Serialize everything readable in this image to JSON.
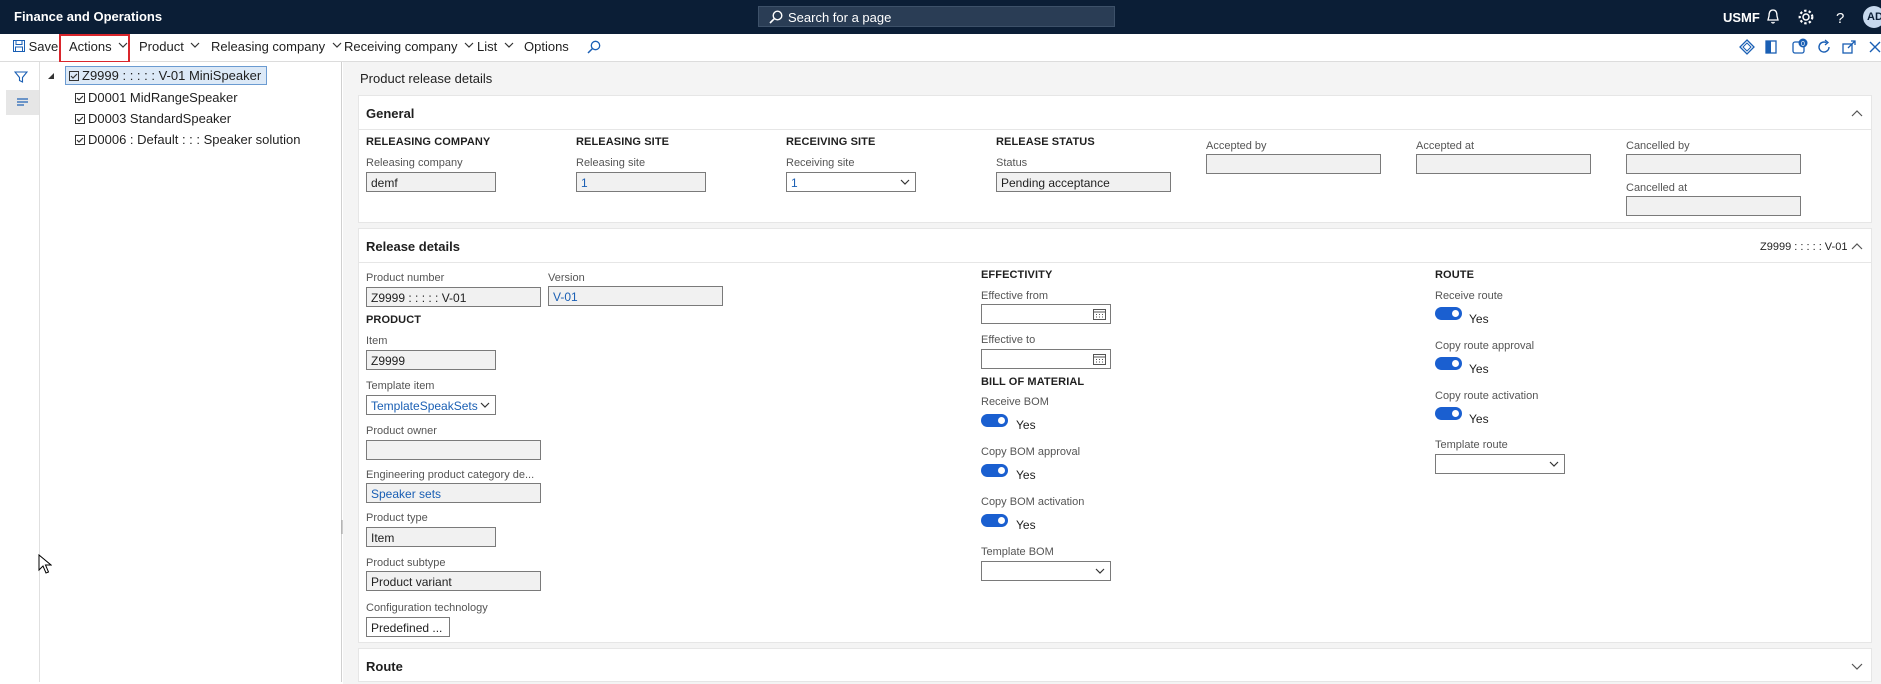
{
  "topbar": {
    "app_title": "Finance and Operations",
    "search_placeholder": "Search for a page",
    "company": "USMF",
    "avatar": "AD",
    "icons": [
      "bell-icon",
      "gear-icon",
      "help-icon"
    ]
  },
  "actionbar": {
    "save": "Save",
    "actions": "Actions",
    "product": "Product",
    "releasing_company": "Releasing company",
    "receiving_company": "Receiving company",
    "list": "List",
    "options": "Options",
    "badge_count": "0"
  },
  "tree": {
    "root": "Z9999 : : : : : V-01 MiniSpeaker",
    "children": [
      "D0001 MidRangeSpeaker",
      "D0003 StandardSpeaker",
      "D0006 : Default : : : Speaker solution"
    ]
  },
  "page_title": "Product release details",
  "general": {
    "title": "General",
    "releasing_company_group": "RELEASING COMPANY",
    "releasing_company_label": "Releasing company",
    "releasing_company_value": "demf",
    "releasing_site_group": "RELEASING SITE",
    "releasing_site_label": "Releasing site",
    "releasing_site_value": "1",
    "receiving_site_group": "RECEIVING SITE",
    "receiving_site_label": "Receiving site",
    "receiving_site_value": "1",
    "release_status_group": "RELEASE STATUS",
    "status_label": "Status",
    "status_value": "Pending acceptance",
    "accepted_by_label": "Accepted by",
    "accepted_by_value": "",
    "accepted_at_label": "Accepted at",
    "accepted_at_value": "",
    "cancelled_by_label": "Cancelled by",
    "cancelled_by_value": "",
    "cancelled_at_label": "Cancelled at",
    "cancelled_at_value": ""
  },
  "release_details": {
    "title": "Release details",
    "summary": "Z9999 : : : : : V-01",
    "product_number_label": "Product number",
    "product_number_value": "Z9999 : : : : : V-01",
    "version_label": "Version",
    "version_value": "V-01",
    "product_group": "PRODUCT",
    "item_label": "Item",
    "item_value": "Z9999",
    "template_item_label": "Template item",
    "template_item_value": "TemplateSpeakSets",
    "product_owner_label": "Product owner",
    "product_owner_value": "",
    "eng_category_label": "Engineering product category de...",
    "eng_category_value": "Speaker sets",
    "product_type_label": "Product type",
    "product_type_value": "Item",
    "product_subtype_label": "Product subtype",
    "product_subtype_value": "Product variant",
    "config_tech_label": "Configuration technology",
    "config_tech_value": "Predefined ...",
    "effectivity_group": "EFFECTIVITY",
    "effective_from_label": "Effective from",
    "effective_from_value": "",
    "effective_to_label": "Effective to",
    "effective_to_value": "",
    "bom_group": "BILL OF MATERIAL",
    "receive_bom_label": "Receive BOM",
    "receive_bom_value": "Yes",
    "copy_bom_approval_label": "Copy BOM approval",
    "copy_bom_approval_value": "Yes",
    "copy_bom_activation_label": "Copy BOM activation",
    "copy_bom_activation_value": "Yes",
    "template_bom_label": "Template BOM",
    "template_bom_value": "",
    "route_group": "ROUTE",
    "receive_route_label": "Receive route",
    "receive_route_value": "Yes",
    "copy_route_approval_label": "Copy route approval",
    "copy_route_approval_value": "Yes",
    "copy_route_activation_label": "Copy route activation",
    "copy_route_activation_value": "Yes",
    "template_route_label": "Template route",
    "template_route_value": ""
  },
  "route": {
    "title": "Route"
  },
  "colors": {
    "topbar": "#0b1e36",
    "accent": "#1a5fd0",
    "highlight_box": "#d9262c"
  }
}
